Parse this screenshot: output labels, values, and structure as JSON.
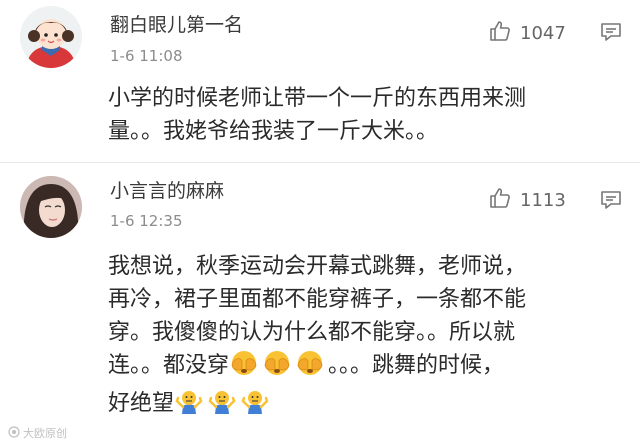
{
  "comments": [
    {
      "username": "翻白眼儿第一名",
      "timestamp": "1-6 11:08",
      "likes": "1047",
      "text_lines": [
        "小学的时候老师让带一个一斤的东西用来测",
        "量。。我姥爷给我装了一斤大米。。"
      ]
    },
    {
      "username": "小言言的麻麻",
      "timestamp": "1-6 12:35",
      "likes": "1113",
      "text_lines": [
        "我想说，秋季运动会开幕式跳舞，老师说，",
        "再冷，裙子里面都不能穿裤子，一条都不能",
        "穿。我傻傻的认为什么都不能穿。。所以就",
        "连。。都没穿",
        "。。。跳舞的时候，",
        "好绝望"
      ]
    }
  ],
  "icons": {
    "like": "thumbs-up-icon",
    "reply": "comment-icon",
    "face_cover": "face-covering-eyes-emoji",
    "shrug": "shrug-emoji"
  },
  "watermark": "大欧原创"
}
